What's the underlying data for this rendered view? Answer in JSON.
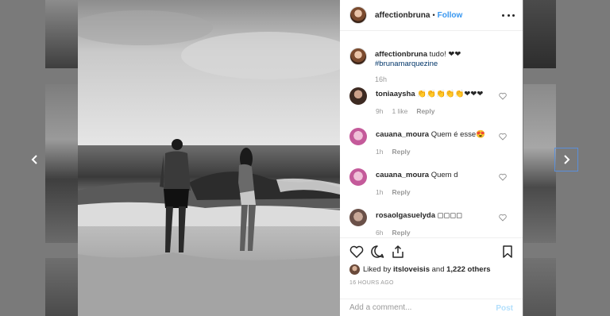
{
  "post": {
    "username": "affectionbruna",
    "separator": "•",
    "follow_label": "Follow",
    "more_icon": "more-horizontal-icon"
  },
  "caption": {
    "username": "affectionbruna",
    "text": "tudo! ❤❤",
    "hashtag": "#brunamarquezine",
    "time": "16h"
  },
  "comments": [
    {
      "username": "toniaaysha",
      "text": "👏👏👏👏👏❤❤❤",
      "time": "9h",
      "likes": "1 like",
      "reply": "Reply"
    },
    {
      "username": "cauana_moura",
      "text": "Quem é esse😍",
      "time": "1h",
      "reply": "Reply"
    },
    {
      "username": "cauana_moura",
      "text": "Quem d",
      "time": "1h",
      "reply": "Reply"
    },
    {
      "username": "rosaolgasuelyda",
      "text": "◻◻◻◻",
      "time": "6h",
      "reply": "Reply"
    }
  ],
  "actions": {
    "liked_by_prefix": "Liked by",
    "liked_by_user": "itsloveisis",
    "liked_by_mid": "and",
    "liked_by_others": "1,222 others",
    "time_ago": "16 HOURS AGO",
    "comment_placeholder": "Add a comment...",
    "post_label": "Post"
  },
  "colors": {
    "link_blue": "#3897f0",
    "hashtag_blue": "#003569",
    "muted": "#999999",
    "post_disabled": "#b2dffc"
  }
}
